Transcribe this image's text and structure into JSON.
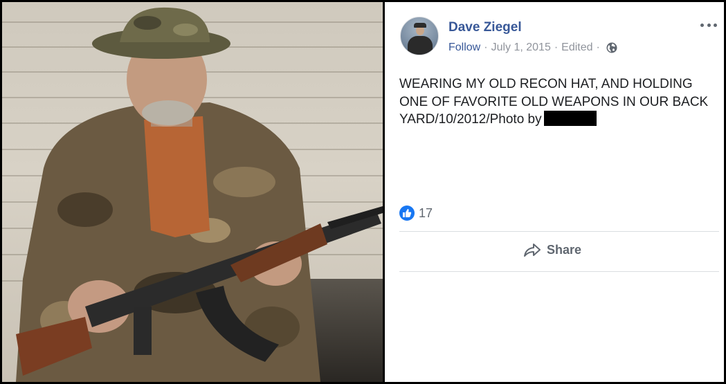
{
  "post": {
    "author": "Dave Ziegel",
    "follow_label": "Follow",
    "date": "July 1, 2015",
    "edited_label": "Edited",
    "separator": "·",
    "text": "WEARING MY OLD RECON HAT, AND HOLDING ONE OF FAVORITE OLD WEAPONS IN OUR BACK YARD/10/2012/Photo by",
    "like_count": "17",
    "share_label": "Share"
  },
  "icons": {
    "more": "more-options-icon",
    "audience": "globe-icon",
    "reaction": "like-icon",
    "share": "share-arrow-icon"
  },
  "colors": {
    "author": "#385898",
    "meta": "#90949c",
    "like_badge": "#1877f2",
    "action_text": "#606770"
  }
}
